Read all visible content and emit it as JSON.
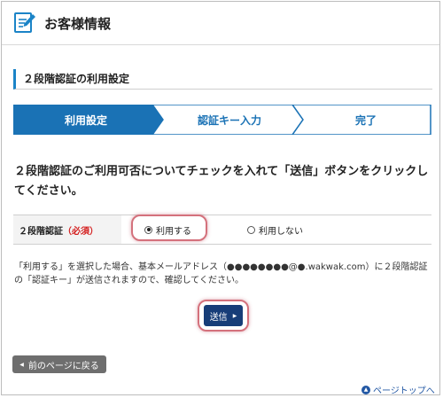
{
  "header": {
    "title": "お客様情報",
    "icon": "edit-document-icon"
  },
  "section": {
    "title": "２段階認証の利用設定"
  },
  "steps": [
    {
      "label": "利用設定",
      "active": true
    },
    {
      "label": "認証キー入力",
      "active": false
    },
    {
      "label": "完了",
      "active": false
    }
  ],
  "question": "２段階認証のご利用可否についてチェックを入れて「送信」ボタンをクリックしてください。",
  "form": {
    "label": "２段階認証",
    "required": "（必須）",
    "options": [
      {
        "label": "利用する",
        "selected": true
      },
      {
        "label": "利用しない",
        "selected": false
      }
    ]
  },
  "note": "「利用する」を選択した場合、基本メールアドレス（●●●●●●●●@●.wakwak.com）に２段階認証の「認証キー」が送信されますので、確認してください。",
  "buttons": {
    "submit": "送信",
    "back": "前のページに戻る"
  },
  "links": {
    "page_top": "ページトップへ"
  },
  "colors": {
    "accent": "#1b84c7",
    "step_active": "#1a72b5",
    "submit_bg": "#173d78",
    "required": "#d42020",
    "highlight": "#d4717c"
  }
}
